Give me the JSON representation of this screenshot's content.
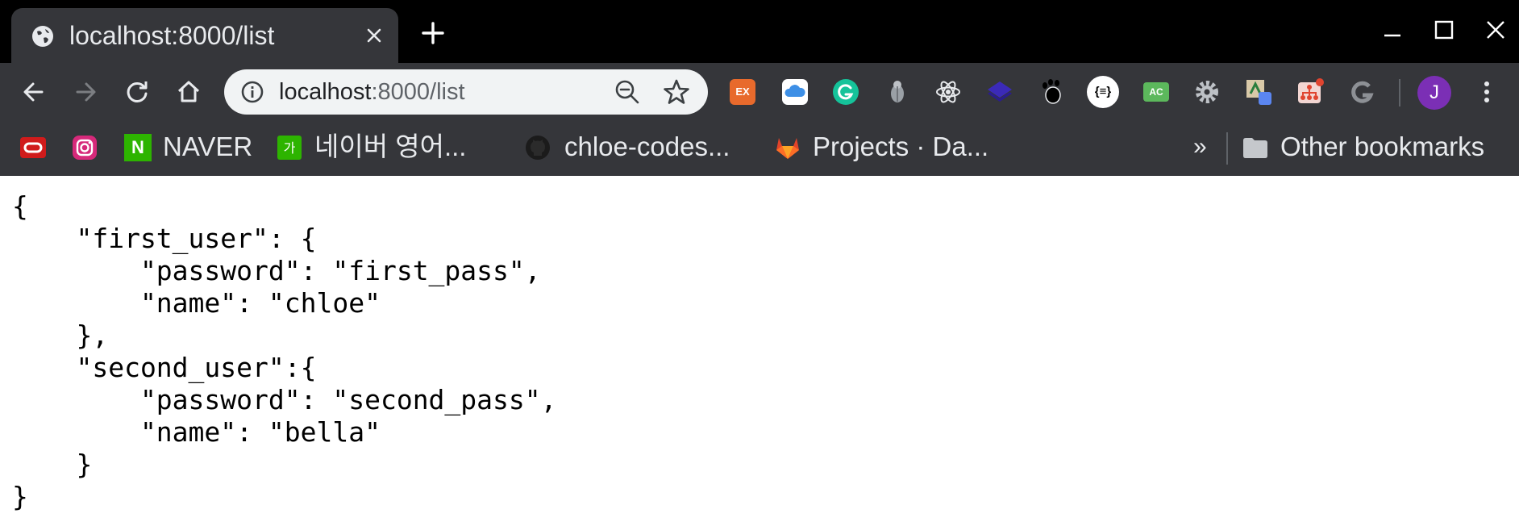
{
  "tab": {
    "title": "localhost:8000/list",
    "favicon": "globe-icon"
  },
  "window_controls": [
    "minimize-icon",
    "maximize-icon",
    "close-icon"
  ],
  "nav": {
    "back": "back-arrow-icon",
    "forward": "forward-arrow-icon",
    "reload": "reload-icon",
    "home": "home-icon"
  },
  "omnibox": {
    "url_host": "localhost",
    "url_rest": ":8000/list",
    "icons": [
      "info-icon",
      "zoom-out-icon",
      "star-icon"
    ]
  },
  "extensions": {
    "ex_label": "EX",
    "ac_label": "AC",
    "json_label": "{≡}",
    "grammarly_label": "G"
  },
  "profile": {
    "initial": "J",
    "color": "#7b2fb5"
  },
  "bookmarks": {
    "items": [
      {
        "label": ""
      },
      {
        "label": ""
      },
      {
        "label": "NAVER"
      },
      {
        "label": "네이버 영어..."
      },
      {
        "label": "chloe-codes..."
      },
      {
        "label": "Projects · Da..."
      }
    ],
    "more": "»",
    "other": "Other bookmarks",
    "naver_badge": "N",
    "dict_badge": "가"
  },
  "content": {
    "json_text": "{\n    \"first_user\": {\n        \"password\": \"first_pass\",\n        \"name\": \"chloe\"\n    },\n    \"second_user\":{\n        \"password\": \"second_pass\",\n        \"name\": \"bella\"\n    }\n}"
  },
  "colors": {
    "tabstrip": "#000000",
    "toolbar": "#35363a",
    "omnibox": "#f1f3f4",
    "content_bg": "#ffffff"
  }
}
